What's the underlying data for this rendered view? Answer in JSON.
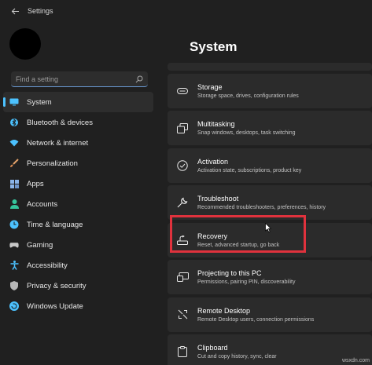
{
  "window": {
    "title": "Settings"
  },
  "search": {
    "placeholder": "Find a setting"
  },
  "sidebar": {
    "items": [
      {
        "label": "System",
        "icon": "system-icon",
        "color": "#4cc2ff",
        "active": true
      },
      {
        "label": "Bluetooth & devices",
        "icon": "bluetooth-icon",
        "color": "#4cc2ff"
      },
      {
        "label": "Network & internet",
        "icon": "wifi-icon",
        "color": "#4cc2ff"
      },
      {
        "label": "Personalization",
        "icon": "brush-icon",
        "color": "#e2a06a"
      },
      {
        "label": "Apps",
        "icon": "apps-icon",
        "color": "#8ab4e8"
      },
      {
        "label": "Accounts",
        "icon": "person-icon",
        "color": "#35c59c"
      },
      {
        "label": "Time & language",
        "icon": "globe-clock-icon",
        "color": "#4cc2ff"
      },
      {
        "label": "Gaming",
        "icon": "gamepad-icon",
        "color": "#c8c8c8"
      },
      {
        "label": "Accessibility",
        "icon": "accessibility-icon",
        "color": "#4cc2ff"
      },
      {
        "label": "Privacy & security",
        "icon": "shield-icon",
        "color": "#b8b8b8"
      },
      {
        "label": "Windows Update",
        "icon": "update-icon",
        "color": "#4cc2ff"
      }
    ]
  },
  "main": {
    "title": "System",
    "cards": [
      {
        "title": "Storage",
        "subtitle": "Storage space, drives, configuration rules",
        "icon": "storage-icon"
      },
      {
        "title": "Multitasking",
        "subtitle": "Snap windows, desktops, task switching",
        "icon": "multitasking-icon"
      },
      {
        "title": "Activation",
        "subtitle": "Activation state, subscriptions, product key",
        "icon": "activation-icon"
      },
      {
        "title": "Troubleshoot",
        "subtitle": "Recommended troubleshooters, preferences, history",
        "icon": "wrench-icon"
      },
      {
        "title": "Recovery",
        "subtitle": "Reset, advanced startup, go back",
        "icon": "recovery-icon",
        "highlighted": true
      },
      {
        "title": "Projecting to this PC",
        "subtitle": "Permissions, pairing PIN, discoverability",
        "icon": "projector-icon"
      },
      {
        "title": "Remote Desktop",
        "subtitle": "Remote Desktop users, connection permissions",
        "icon": "remote-desktop-icon"
      },
      {
        "title": "Clipboard",
        "subtitle": "Cut and copy history, sync, clear",
        "icon": "clipboard-icon"
      }
    ]
  },
  "highlight_color": "#e0323d",
  "watermark": "wsxdn.com"
}
